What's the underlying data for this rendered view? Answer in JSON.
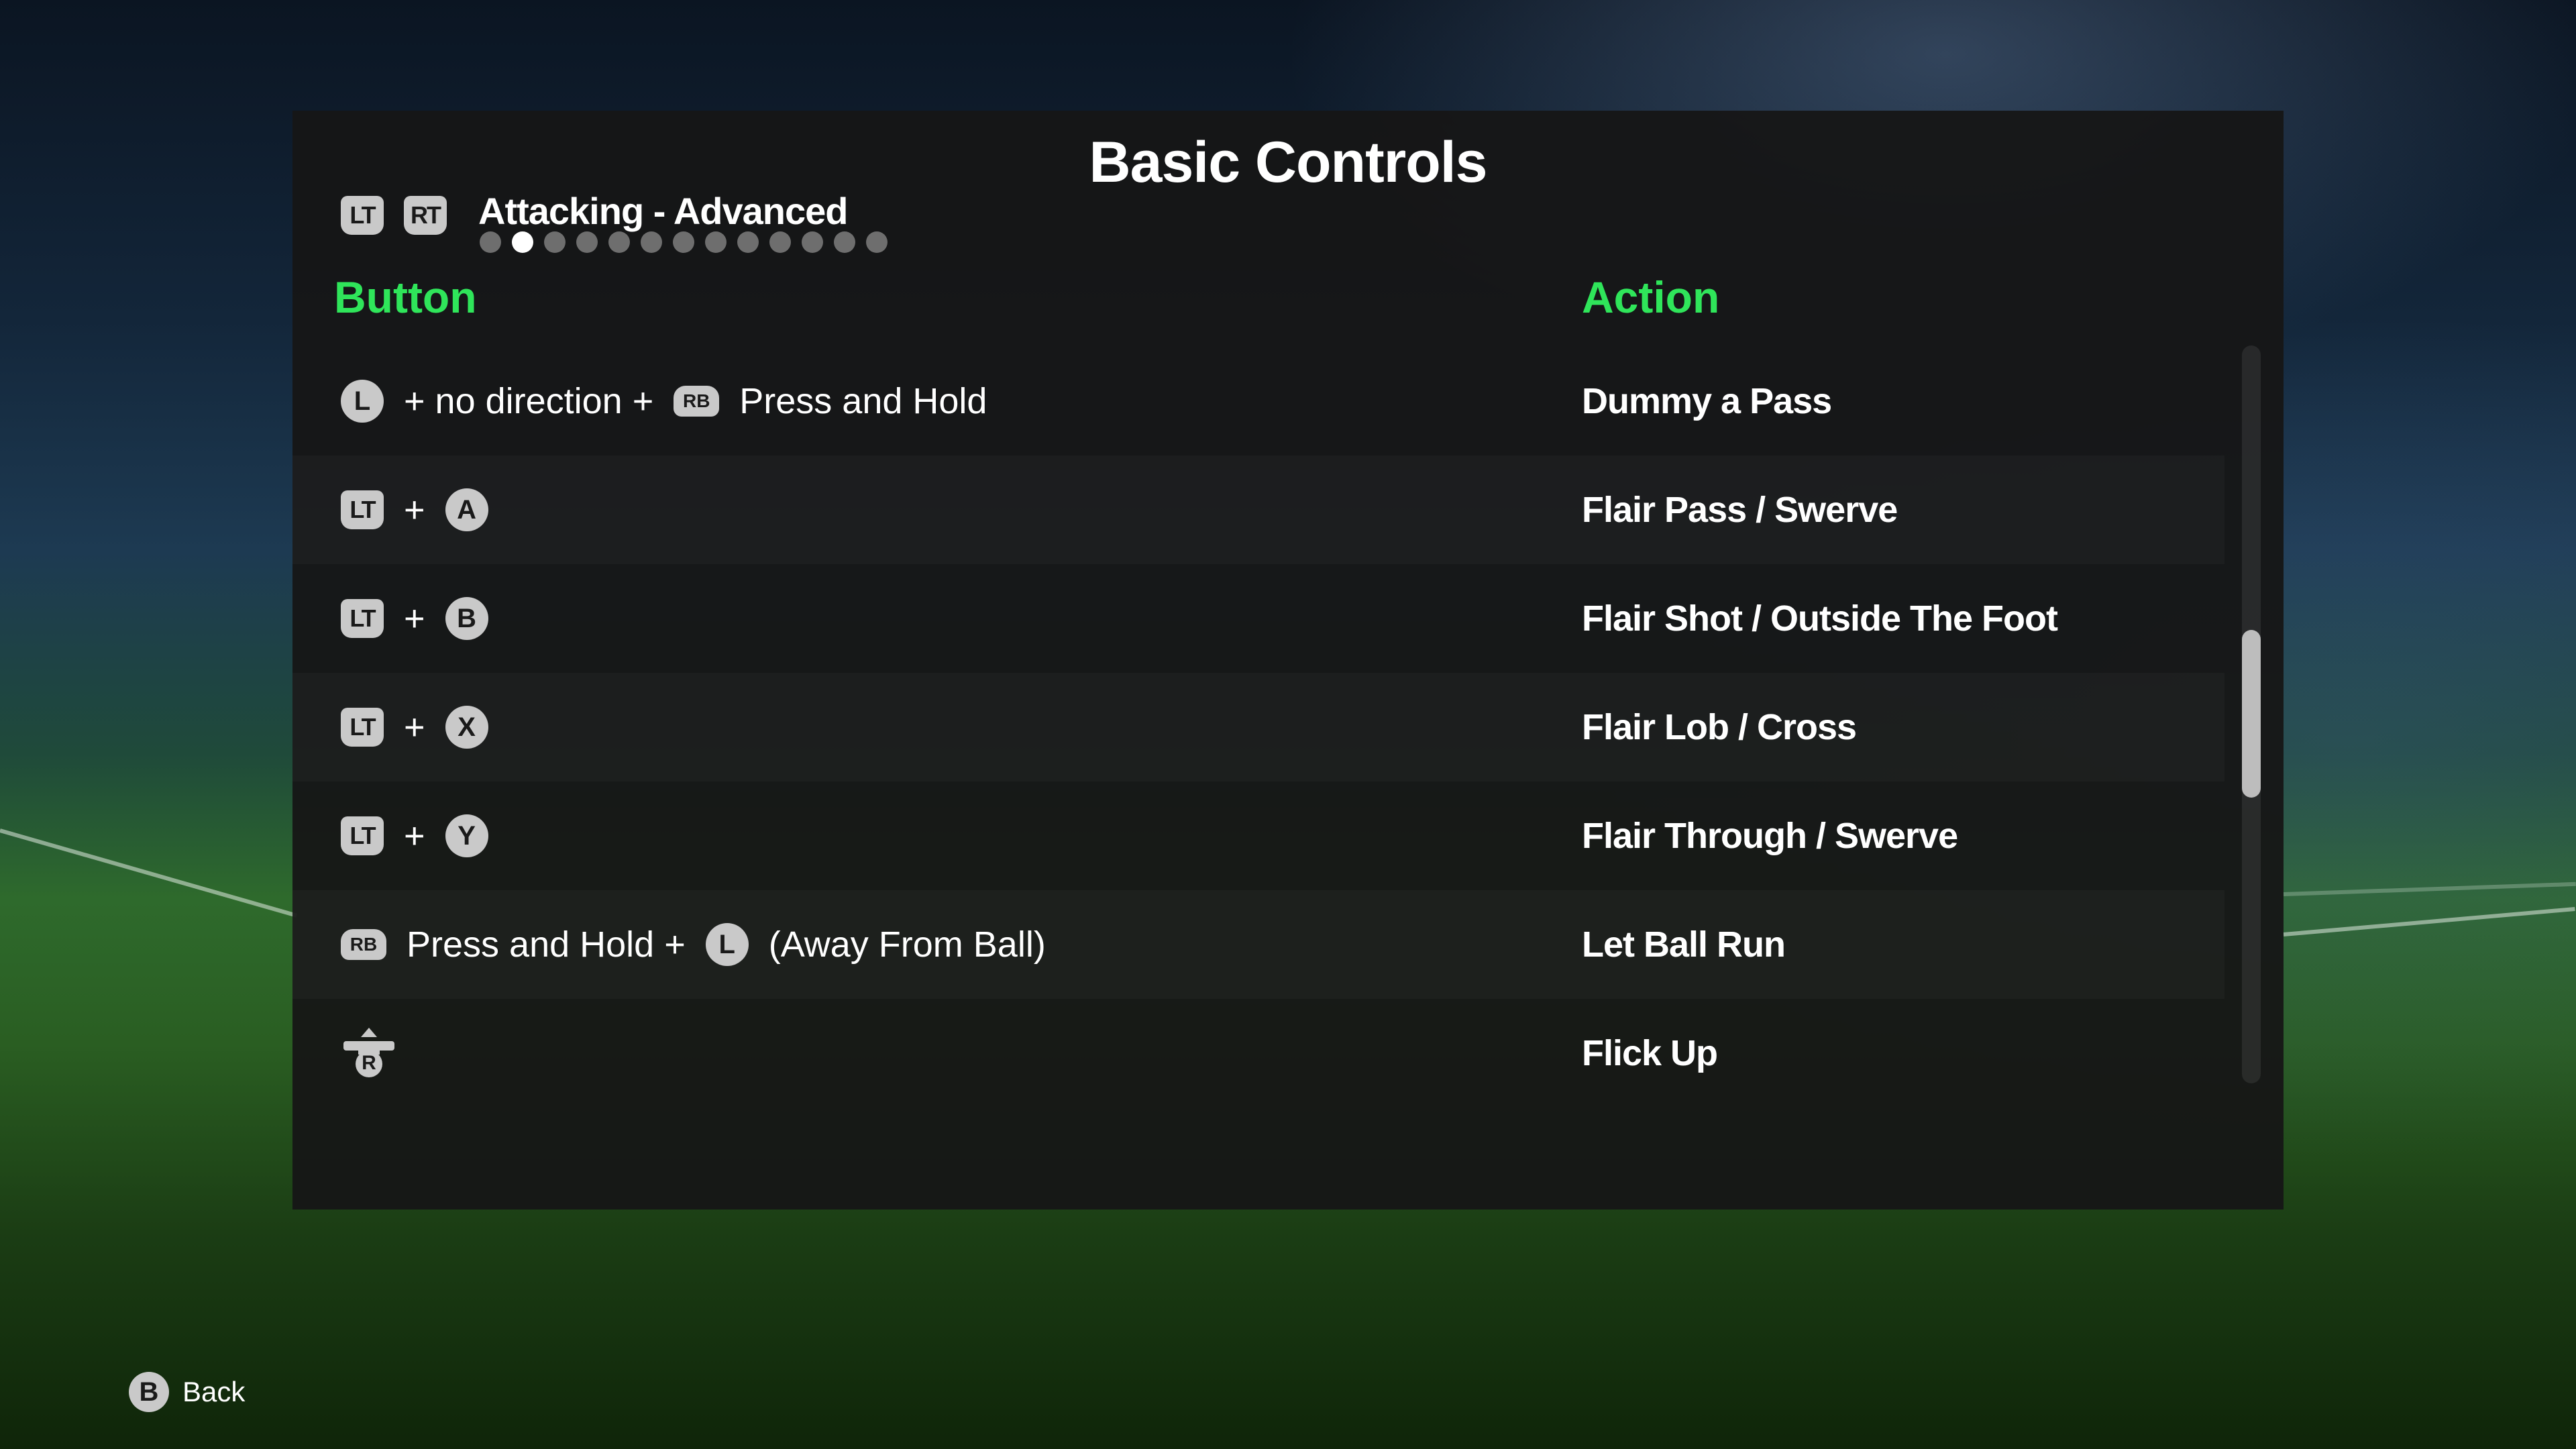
{
  "title": "Basic Controls",
  "nav": {
    "prev_trigger": "LT",
    "next_trigger": "RT",
    "section": "Attacking - Advanced",
    "page_count": 13,
    "active_page": 2
  },
  "columns": {
    "button": "Button",
    "action": "Action"
  },
  "rows": [
    {
      "parts": [
        "L",
        "+ no direction +",
        "RB",
        "Press and Hold"
      ],
      "action": "Dummy a Pass"
    },
    {
      "parts": [
        "LT",
        "+",
        "A"
      ],
      "action": "Flair Pass / Swerve"
    },
    {
      "parts": [
        "LT",
        "+",
        "B"
      ],
      "action": "Flair Shot / Outside The Foot"
    },
    {
      "parts": [
        "LT",
        "+",
        "X"
      ],
      "action": "Flair Lob / Cross"
    },
    {
      "parts": [
        "LT",
        "+",
        "Y"
      ],
      "action": "Flair Through / Swerve"
    },
    {
      "parts": [
        "RB",
        "Press and Hold +",
        "L",
        "(Away From Ball)"
      ],
      "action": "Let Ball Run"
    },
    {
      "parts": [
        "R"
      ],
      "action": "Flick Up"
    }
  ],
  "footer": {
    "back_key": "B",
    "back_label": "Back"
  },
  "colors": {
    "accent_green": "#2fe55a",
    "panel": "#161616",
    "button_glyph": "#c9c9c9"
  }
}
